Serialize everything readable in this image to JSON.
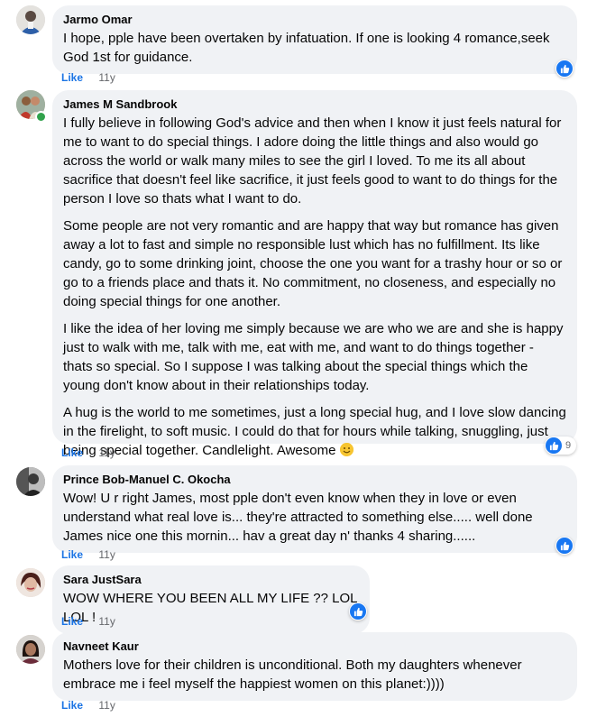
{
  "comments": [
    {
      "author": "Jarmo Omar",
      "paragraphs": [
        "I hope, pple have been overtaken by infatuation. If one is looking 4 romance,seek God 1st for guidance."
      ],
      "like_label": "Like",
      "time": "11y",
      "reaction_count": ""
    },
    {
      "author": "James M Sandbrook",
      "paragraphs": [
        "I fully believe in following God's advice and then when I know it just feels natural for me to want to do special things. I adore doing the little things and also would go across the world or walk many miles to see the girl I loved. To me its all about sacrifice that doesn't feel like sacrifice, it just feels good to want to do things for the person I love so thats what I want to do.",
        "Some people are not very romantic and are happy that way but romance has given away a lot to fast and simple no responsible lust which has no fulfillment. Its like candy, go to some drinking joint, choose the one you want for a trashy hour or so or go to a friends place and thats it. No commitment, no closeness, and especially no doing special things for one another.",
        "I like the idea of her loving me simply because we are who we are and she is happy just to walk with me, talk with me, eat with me, and want to do things together - thats so special. So I suppose I was talking about the special things which the young don't know about in their relationships today.",
        "A hug is the world to me sometimes, just a long special hug, and I love slow dancing in the firelight, to soft music. I could do that for hours while talking, snuggling, just being special together. Candlelight. Awesome"
      ],
      "like_label": "Like",
      "time": "11y",
      "reaction_count": "9"
    },
    {
      "author": "Prince Bob-Manuel C. Okocha",
      "paragraphs": [
        "Wow! U r right James, most pple don't even know when they in love or even understand what real love is... they're attracted to something else..... well done James nice one this mornin... hav a great day n' thanks 4 sharing......"
      ],
      "like_label": "Like",
      "time": "11y",
      "reaction_count": ""
    },
    {
      "author": "Sara JustSara",
      "paragraphs": [
        "WOW WHERE YOU BEEN ALL MY LIFE ?? LOL LOL !"
      ],
      "like_label": "Like",
      "time": "11y",
      "reaction_count": ""
    },
    {
      "author": "Navneet Kaur",
      "paragraphs": [
        "Mothers love for their children is unconditional. Both my daughters whenever embrace me i feel myself the happiest women on this planet:))))"
      ],
      "like_label": "Like",
      "time": "11y",
      "reaction_count": ""
    }
  ],
  "icons": {
    "reaction": "thumbs-up-icon",
    "emoji": "smiling-face-emoji-icon",
    "online": "online-status-dot"
  },
  "colors": {
    "bubble": "#f0f2f5",
    "like_link": "#1b74e4",
    "reaction": "#1877f2",
    "online": "#31a24c",
    "meta_text": "#65676b"
  }
}
